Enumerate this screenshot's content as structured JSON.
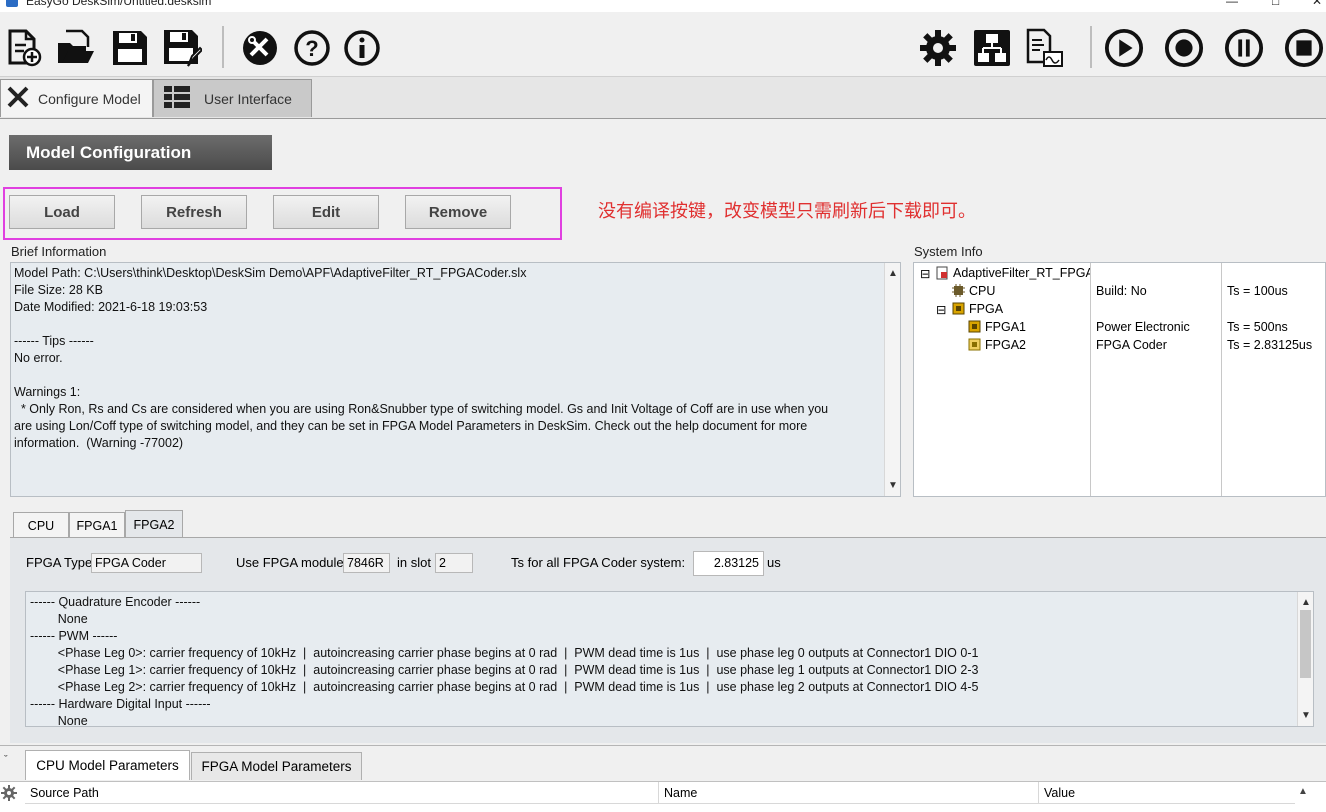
{
  "window": {
    "title": "EasyGo DeskSim/Untitled.desksim"
  },
  "toolbar": {
    "icons": [
      "new-file-icon",
      "open-folder-icon",
      "save-icon",
      "save-as-icon",
      "tools-icon",
      "help-icon",
      "info-icon",
      "settings-gear-icon",
      "network-icon",
      "report-icon",
      "run-icon",
      "record-icon",
      "pause-icon",
      "stop-icon"
    ]
  },
  "mode_tabs": [
    {
      "label": "Configure Model",
      "active": true
    },
    {
      "label": "User Interface",
      "active": false
    }
  ],
  "model_config": {
    "header": "Model Configuration",
    "buttons": {
      "load": "Load",
      "refresh": "Refresh",
      "edit": "Edit",
      "remove": "Remove"
    },
    "annotation": "没有编译按键，改变模型只需刷新后下载即可。"
  },
  "brief_info": {
    "label": "Brief Information",
    "lines": [
      "Model Path: C:\\Users\\think\\Desktop\\DeskSim Demo\\APF\\AdaptiveFilter_RT_FPGACoder.slx",
      "File Size: 28 KB",
      "Date Modified: 2021-6-18 19:03:53",
      "",
      "------ Tips ------",
      "No error.",
      "",
      "Warnings 1:",
      "  * Only Ron, Rs and Cs are considered when you are using Ron&Snubber type of switching model. Gs and Init Voltage of Coff are in use when you",
      "are using Lon/Coff type of switching model, and they can be set in FPGA Model Parameters in DeskSim. Check out the help document for more",
      "information.  (Warning -77002)"
    ]
  },
  "system_info": {
    "label": "System Info",
    "tree": [
      {
        "name": "AdaptiveFilter_RT_FPGA(",
        "col2": "",
        "col3": ""
      },
      {
        "name": "CPU",
        "col2": "Build: No",
        "col3": "Ts = 100us"
      },
      {
        "name": "FPGA",
        "col2": "",
        "col3": ""
      },
      {
        "name": "FPGA1",
        "col2": "Power Electronic",
        "col3": "Ts = 500ns"
      },
      {
        "name": "FPGA2",
        "col2": "FPGA Coder",
        "col3": "Ts = 2.83125us"
      }
    ]
  },
  "sub_tabs": [
    {
      "label": "CPU",
      "active": false
    },
    {
      "label": "FPGA1",
      "active": false
    },
    {
      "label": "FPGA2",
      "active": true
    }
  ],
  "fpga_panel": {
    "type_label": "FPGA Type",
    "type_value": "FPGA Coder",
    "module_label": "Use FPGA module",
    "module_value": "7846R",
    "slot_label": "in slot",
    "slot_value": "2",
    "ts_label": "Ts for all FPGA Coder system:",
    "ts_value": "2.83125",
    "ts_unit": "us",
    "log_lines": [
      "------ Quadrature Encoder ------",
      "        None",
      "------ PWM ------",
      "        <Phase Leg 0>: carrier frequency of 10kHz  |  autoincreasing carrier phase begins at 0 rad  |  PWM dead time is 1us  |  use phase leg 0 outputs at Connector1 DIO 0-1",
      "        <Phase Leg 1>: carrier frequency of 10kHz  |  autoincreasing carrier phase begins at 0 rad  |  PWM dead time is 1us  |  use phase leg 1 outputs at Connector1 DIO 2-3",
      "        <Phase Leg 2>: carrier frequency of 10kHz  |  autoincreasing carrier phase begins at 0 rad  |  PWM dead time is 1us  |  use phase leg 2 outputs at Connector1 DIO 4-5",
      "------ Hardware Digital Input ------",
      "        None"
    ]
  },
  "bottom_tabs": [
    {
      "label": "CPU Model Parameters",
      "active": true
    },
    {
      "label": "FPGA Model Parameters",
      "active": false
    }
  ],
  "params_grid": {
    "columns": [
      "Source Path",
      "Name",
      "Value"
    ]
  }
}
